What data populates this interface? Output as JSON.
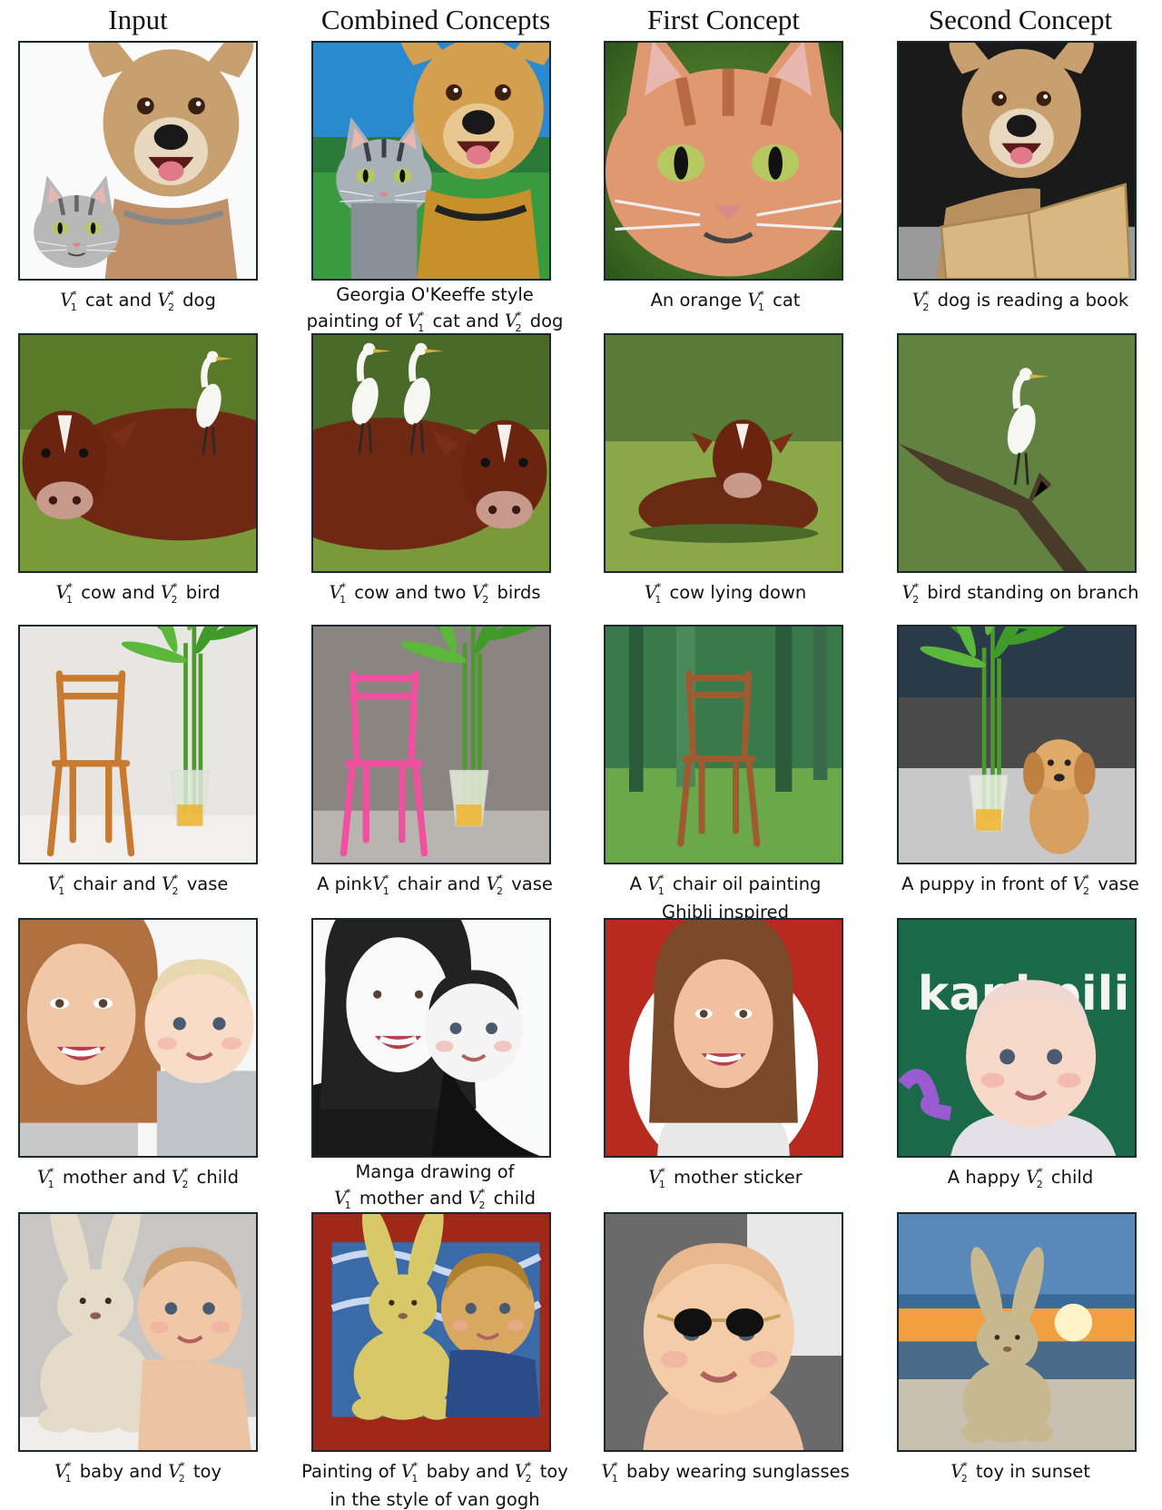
{
  "columns": [
    "Input",
    "Combined Concepts",
    "First Concept",
    "Second Concept"
  ],
  "rows": [
    {
      "cells": [
        {
          "caption": [
            [
              "V1",
              " cat and ",
              "V2",
              " dog"
            ]
          ]
        },
        {
          "caption": [
            [
              "Georgia O'Keeffe style"
            ],
            [
              "painting of ",
              "V1",
              " cat and ",
              "V2",
              " dog"
            ]
          ]
        },
        {
          "caption": [
            [
              "An orange ",
              "V1",
              " cat"
            ]
          ]
        },
        {
          "caption": [
            [
              "V2",
              " dog is reading a book"
            ]
          ]
        }
      ]
    },
    {
      "cells": [
        {
          "caption": [
            [
              "V1",
              " cow and ",
              "V2",
              " bird"
            ]
          ]
        },
        {
          "caption": [
            [
              "V1",
              " cow and two ",
              "V2",
              " birds"
            ]
          ]
        },
        {
          "caption": [
            [
              "V1",
              " cow lying down"
            ]
          ]
        },
        {
          "caption": [
            [
              "V2",
              " bird standing on branch"
            ]
          ]
        }
      ]
    },
    {
      "cells": [
        {
          "caption": [
            [
              "V1",
              " chair and ",
              "V2",
              " vase"
            ]
          ]
        },
        {
          "caption": [
            [
              "A pink",
              "V1",
              " chair and ",
              "V2",
              " vase"
            ]
          ]
        },
        {
          "caption": [
            [
              "A ",
              "V1",
              " chair oil painting"
            ],
            [
              "Ghibli inspired"
            ]
          ]
        },
        {
          "caption": [
            [
              "A puppy in front of ",
              "V2",
              " vase"
            ]
          ]
        }
      ]
    },
    {
      "cells": [
        {
          "caption": [
            [
              "V1",
              " mother and ",
              "V2",
              " child"
            ]
          ]
        },
        {
          "caption": [
            [
              "Manga drawing of"
            ],
            [
              "V1",
              " mother and ",
              "V2",
              " child"
            ]
          ]
        },
        {
          "caption": [
            [
              "V1",
              " mother sticker"
            ]
          ]
        },
        {
          "caption": [
            [
              "A happy ",
              "V2",
              " child"
            ]
          ]
        }
      ]
    },
    {
      "cells": [
        {
          "caption": [
            [
              "V1",
              " baby and ",
              "V2",
              " toy"
            ]
          ]
        },
        {
          "caption": [
            [
              "Painting of ",
              "V1",
              " baby and ",
              "V2",
              " toy"
            ],
            [
              "in the style of van gogh"
            ]
          ]
        },
        {
          "caption": [
            [
              "V1",
              " baby wearing sunglasses"
            ]
          ]
        },
        {
          "caption": [
            [
              "V2",
              " toy in sunset"
            ]
          ]
        }
      ]
    }
  ],
  "image_texts": {
    "kapi_sign": "kapi  pili"
  }
}
